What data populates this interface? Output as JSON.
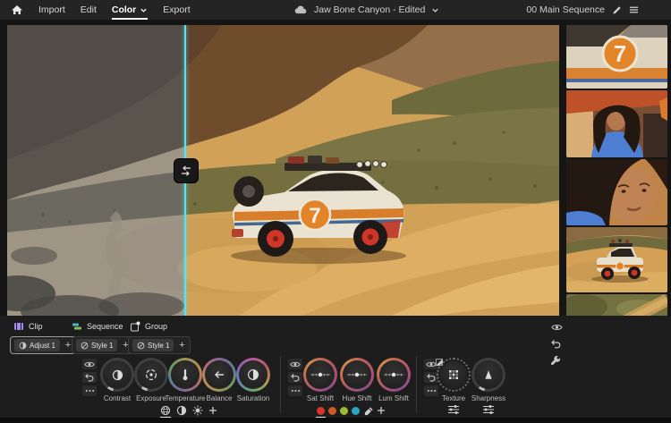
{
  "topbar": {
    "menu": {
      "import": "Import",
      "edit": "Edit",
      "color": "Color",
      "export": "Export"
    },
    "project_title": "Jaw Bone Canyon - Edited",
    "sequence_name": "00 Main Sequence"
  },
  "viewer": {
    "car_number": "7"
  },
  "panel": {
    "tabs": {
      "clip": "Clip",
      "sequence": "Sequence",
      "group": "Group"
    },
    "presets": {
      "adjust": "Adjust 1",
      "style_seq": "Style 1",
      "style_grp": "Style 1",
      "add": "+"
    },
    "wheels": {
      "basic": [
        "Contrast",
        "Exposure",
        "Temperature",
        "Balance",
        "Saturation"
      ],
      "hsl": [
        "Sat Shift",
        "Hue Shift",
        "Lum Shift"
      ],
      "detail": [
        "Texture",
        "Sharpness"
      ]
    },
    "swatches": {
      "red": "#d8352a",
      "orange": "#cd5b20",
      "green": "#9dbb2f",
      "cyan": "#2aa5c0"
    }
  },
  "colors": {
    "split_line": "#5ce1f0",
    "selected_outline": "#9b9b9b"
  }
}
